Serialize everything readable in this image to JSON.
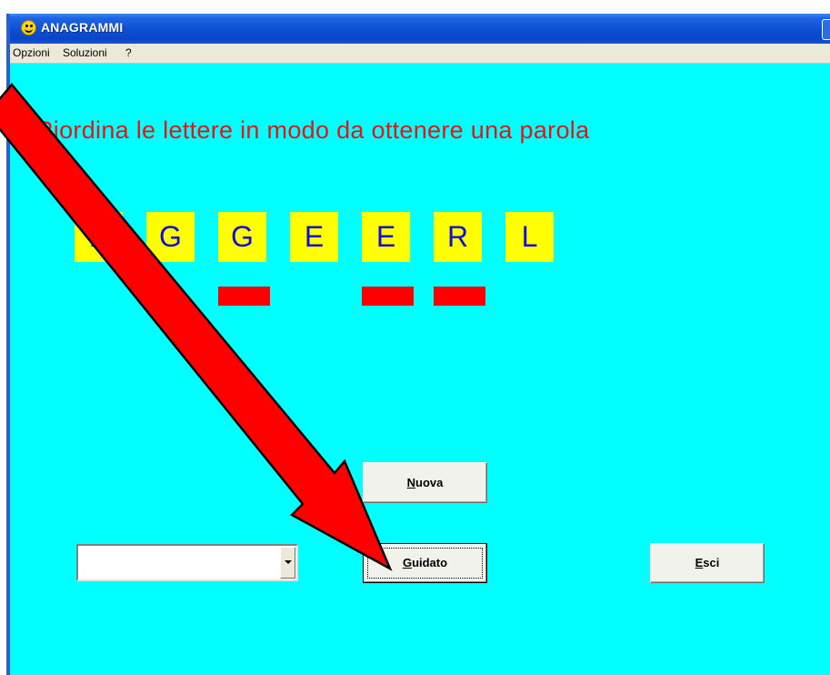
{
  "window": {
    "title": "ANAGRAMMI",
    "icon": "smiley-icon"
  },
  "menu": {
    "items": [
      "Opzioni",
      "Soluzioni",
      "?"
    ]
  },
  "game": {
    "instruction": "Riordina le lettere in modo da ottenere una parola",
    "letters": [
      "E",
      "G",
      "G",
      "E",
      "E",
      "R",
      "L"
    ]
  },
  "buttons": {
    "nuova": {
      "accel": "N",
      "rest": "uova"
    },
    "guidato": {
      "accel": "G",
      "rest": "uidato"
    },
    "esci": {
      "accel": "E",
      "rest": "sci"
    }
  },
  "combo": {
    "value": ""
  },
  "annotation": {
    "icon": "red-arrow-pointer",
    "color": "#ff0000"
  },
  "colors": {
    "background": "#00ffff",
    "headline": "#e01818",
    "tile": "#ffff00",
    "tile_text": "#1010d8",
    "slot": "#ff0000"
  }
}
